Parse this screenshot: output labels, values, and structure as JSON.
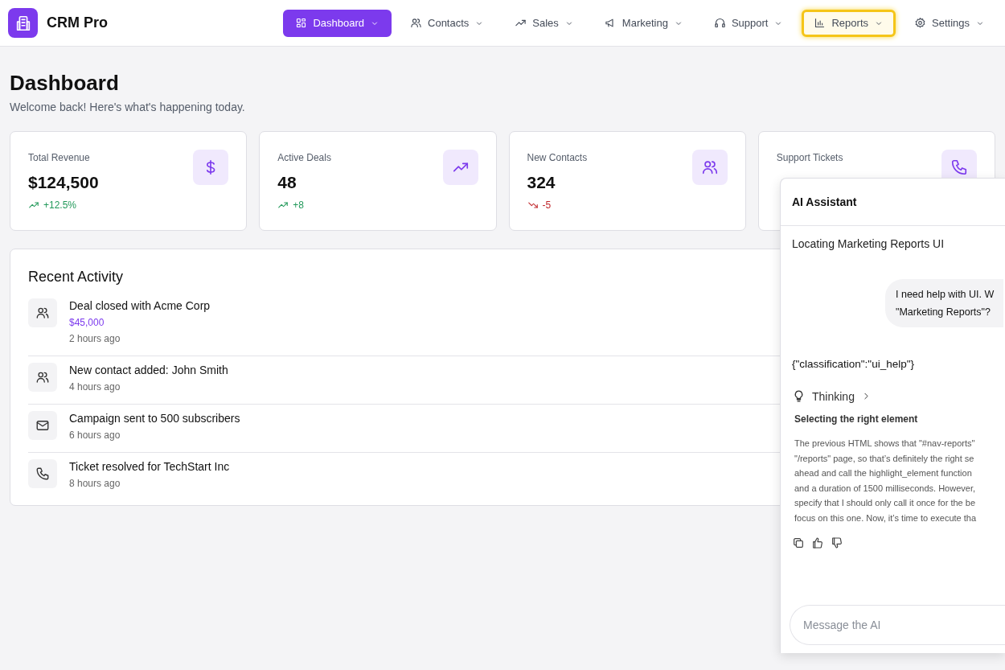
{
  "app": {
    "name": "CRM Pro"
  },
  "nav": [
    {
      "label": "Dashboard",
      "selected": true,
      "highlighted": false
    },
    {
      "label": "Contacts",
      "selected": false,
      "highlighted": false
    },
    {
      "label": "Sales",
      "selected": false,
      "highlighted": false
    },
    {
      "label": "Marketing",
      "selected": false,
      "highlighted": false
    },
    {
      "label": "Support",
      "selected": false,
      "highlighted": false
    },
    {
      "label": "Reports",
      "selected": false,
      "highlighted": true
    },
    {
      "label": "Settings",
      "selected": false,
      "highlighted": false
    }
  ],
  "page": {
    "title": "Dashboard",
    "subtitle": "Welcome back! Here's what's happening today."
  },
  "stats": [
    {
      "label": "Total Revenue",
      "value": "$124,500",
      "change": "+12.5%",
      "kind": "up"
    },
    {
      "label": "Active Deals",
      "value": "48",
      "change": "+8",
      "kind": "up"
    },
    {
      "label": "New Contacts",
      "value": "324",
      "change": "-5",
      "kind": "down"
    },
    {
      "label": "Support Tickets"
    }
  ],
  "activity": {
    "title": "Recent Activity",
    "items": [
      {
        "title": "Deal closed with Acme Corp",
        "amount": "$45,000",
        "time": "2 hours ago"
      },
      {
        "title": "New contact added: John Smith",
        "time": "4 hours ago"
      },
      {
        "title": "Campaign sent to 500 subscribers",
        "time": "6 hours ago"
      },
      {
        "title": "Ticket resolved for TechStart Inc",
        "time": "8 hours ago"
      }
    ]
  },
  "assistant": {
    "title": "AI Assistant",
    "topic": "Locating Marketing Reports UI",
    "user_message": [
      "I need help with UI. W",
      "\"Marketing Reports\"?"
    ],
    "classification": "{\"classification\":\"ui_help\"}",
    "thinking": {
      "label": "Thinking",
      "expanded": false,
      "heading": "Selecting the right element",
      "lines": [
        "The previous HTML shows that \"#nav-reports\"",
        "\"/reports\" page, so that’s definitely the right se",
        "ahead and call the highlight_element function",
        "and a duration of 1500 milliseconds. However,",
        "specify that I should only call it once for the be",
        "focus on this one. Now, it’s time to execute tha"
      ]
    },
    "input": {
      "placeholder": "Message the AI"
    }
  }
}
